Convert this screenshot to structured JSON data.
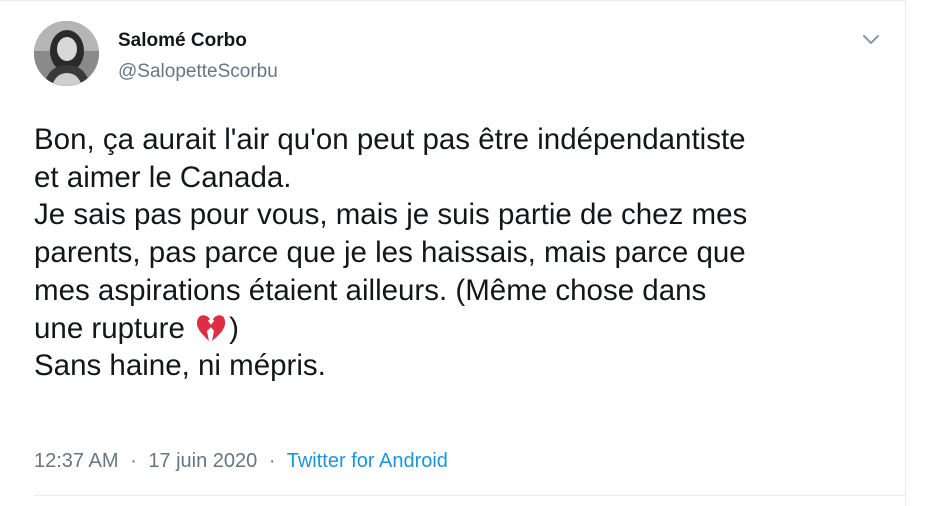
{
  "author": {
    "name": "Salomé Corbo",
    "handle": "@SalopetteScorbu"
  },
  "tweet": {
    "lines": [
      "Bon, ça aurait l'air qu'on peut pas être indépendantiste",
      "et aimer le Canada.",
      "Je sais pas pour vous, mais je suis partie de chez mes",
      "parents, pas parce que je les haissais, mais parce que",
      "mes aspirations étaient ailleurs. (Même chose dans"
    ],
    "line6_before_emoji": "une rupture",
    "line6_after_emoji": ")",
    "emoji": "broken-heart-icon",
    "line7": "Sans haine, ni mépris."
  },
  "meta": {
    "time": "12:37 AM",
    "separator": "·",
    "date": "17 juin 2020",
    "source": "Twitter for Android"
  },
  "colors": {
    "text": "#14171a",
    "secondary": "#657786",
    "link": "#1b95e0",
    "border": "#e6ecf0",
    "emoji": "#dd2e44"
  }
}
